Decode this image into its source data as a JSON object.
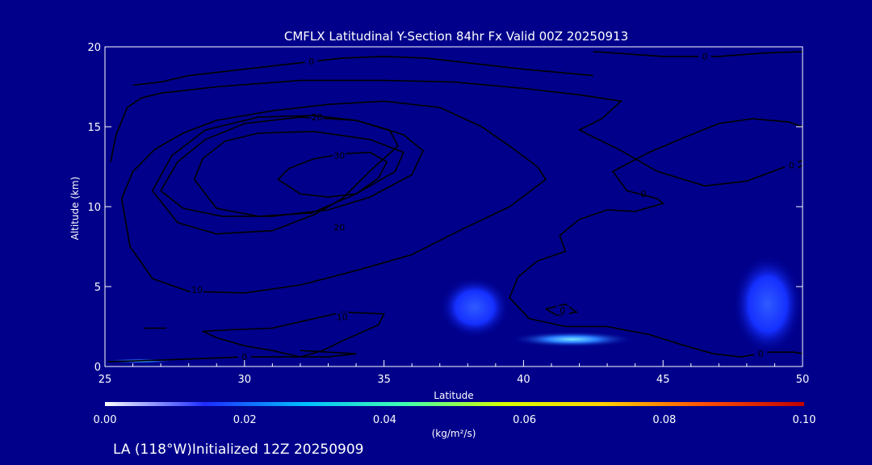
{
  "chart_data": {
    "type": "heatmap",
    "title": "CMFLX Latitudinal Y-Section 84hr  Fx Valid 00Z 20250913",
    "xlabel": "Latitude",
    "ylabel": "Altitude (km)",
    "xlim": [
      25,
      50
    ],
    "ylim": [
      0,
      20
    ],
    "x_ticks": [
      "25",
      "30",
      "35",
      "40",
      "45",
      "50"
    ],
    "y_ticks": [
      "0",
      "5",
      "10",
      "15",
      "20"
    ],
    "grid": false,
    "background_color": "#00008b",
    "contour_color": "#000000",
    "contours": [
      {
        "level": "0",
        "points": [
          [
            26,
            17.6
          ],
          [
            27,
            17.8
          ],
          [
            28,
            18.2
          ],
          [
            30,
            18.6
          ],
          [
            32,
            19.0
          ],
          [
            33.5,
            19.3
          ],
          [
            35,
            19.4
          ],
          [
            36.5,
            19.3
          ],
          [
            38,
            19.0
          ],
          [
            40,
            18.6
          ],
          [
            42.5,
            18.2
          ]
        ],
        "label": [
          32.4,
          19.1
        ]
      },
      {
        "level": "0",
        "points": [
          [
            42.5,
            19.7
          ],
          [
            45,
            19.4
          ],
          [
            47,
            19.4
          ],
          [
            48.5,
            19.6
          ],
          [
            50,
            19.7
          ]
        ],
        "label": [
          46.5,
          19.4
        ]
      },
      {
        "level": "0",
        "points": [
          [
            25.2,
            12.8
          ],
          [
            25.4,
            14.5
          ],
          [
            25.8,
            16.2
          ],
          [
            26.3,
            16.8
          ],
          [
            27,
            17.1
          ],
          [
            29,
            17.5
          ],
          [
            32,
            17.9
          ],
          [
            35,
            17.9
          ],
          [
            37.5,
            17.8
          ],
          [
            40,
            17.4
          ],
          [
            42,
            17.0
          ],
          [
            43.5,
            16.6
          ],
          [
            42.8,
            15.5
          ],
          [
            42,
            14.8
          ],
          [
            43.5,
            13.5
          ],
          [
            44.8,
            12.2
          ],
          [
            46.5,
            11.3
          ],
          [
            48,
            11.6
          ],
          [
            50,
            12.9
          ]
        ],
        "label": [
          44.3,
          10.8
        ]
      },
      {
        "level": "0",
        "points": [
          [
            50,
            15.0
          ],
          [
            49.5,
            15.3
          ],
          [
            48.2,
            15.5
          ],
          [
            47,
            15.2
          ],
          [
            46,
            14.5
          ],
          [
            44.5,
            13.4
          ],
          [
            43.2,
            12.2
          ],
          [
            43.7,
            11.0
          ],
          [
            44.8,
            10.5
          ],
          [
            45,
            10.2
          ],
          [
            44,
            9.7
          ],
          [
            43,
            9.8
          ],
          [
            42,
            9.2
          ],
          [
            41.3,
            8.2
          ],
          [
            41.5,
            7.2
          ],
          [
            40.5,
            6.6
          ],
          [
            39.8,
            5.6
          ],
          [
            39.5,
            4.3
          ],
          [
            40.2,
            3.0
          ],
          [
            41.5,
            2.5
          ],
          [
            43,
            2.5
          ],
          [
            44.5,
            2.0
          ],
          [
            45.8,
            1.3
          ],
          [
            46.8,
            0.8
          ],
          [
            47.8,
            0.6
          ],
          [
            48.8,
            0.9
          ],
          [
            49.7,
            0.9
          ],
          [
            50,
            0.8
          ]
        ],
        "label": [
          48.5,
          0.8
        ]
      },
      {
        "level": "0",
        "points": [
          [
            25.1,
            0.3
          ],
          [
            27,
            0.4
          ],
          [
            30,
            0.6
          ],
          [
            33,
            0.6
          ],
          [
            34,
            0.8
          ],
          [
            32,
            1.0
          ]
        ],
        "label": [
          30,
          0.6
        ]
      },
      {
        "level": "0",
        "points": [
          [
            26.4,
            2.4
          ],
          [
            27.2,
            2.4
          ]
        ],
        "label": null
      },
      {
        "level": "0",
        "points": [
          [
            40.8,
            3.6
          ],
          [
            41.5,
            3.9
          ],
          [
            41.9,
            3.4
          ],
          [
            41.2,
            3.2
          ],
          [
            40.8,
            3.6
          ]
        ],
        "label": [
          41.4,
          3.5
        ]
      },
      {
        "level": "0",
        "points": [
          [
            49.8,
            12.4
          ],
          [
            50,
            12.6
          ]
        ],
        "label": [
          49.6,
          12.6
        ]
      },
      {
        "level": "10",
        "points": [
          [
            25.6,
            10.5
          ],
          [
            26,
            12.2
          ],
          [
            26.8,
            13.6
          ],
          [
            27.8,
            14.6
          ],
          [
            29,
            15.4
          ],
          [
            31,
            16.0
          ],
          [
            33,
            16.4
          ],
          [
            35,
            16.6
          ],
          [
            37,
            16.2
          ],
          [
            38.5,
            15.0
          ],
          [
            39.5,
            13.8
          ],
          [
            40.5,
            12.5
          ],
          [
            40.8,
            11.7
          ],
          [
            39.5,
            10.0
          ],
          [
            37.7,
            8.5
          ],
          [
            36,
            7.0
          ],
          [
            34,
            6.0
          ],
          [
            32,
            5.1
          ],
          [
            30,
            4.6
          ],
          [
            28,
            4.7
          ],
          [
            26.7,
            5.5
          ],
          [
            25.9,
            7.5
          ],
          [
            25.6,
            10.5
          ]
        ],
        "label": [
          28.3,
          4.8
        ]
      },
      {
        "level": "10",
        "points": [
          [
            33.5,
            3.4
          ],
          [
            35,
            3.3
          ],
          [
            34.8,
            2.6
          ],
          [
            33.5,
            1.6
          ],
          [
            32.8,
            1.0
          ],
          [
            32,
            0.6
          ],
          [
            31,
            1.0
          ],
          [
            30,
            1.3
          ],
          [
            29,
            1.8
          ],
          [
            28.5,
            2.2
          ],
          [
            29.5,
            2.3
          ],
          [
            31,
            2.4
          ],
          [
            32.5,
            3.0
          ],
          [
            33.5,
            3.4
          ]
        ],
        "label": [
          33.5,
          3.1
        ]
      },
      {
        "level": "20",
        "points": [
          [
            27,
            11.0
          ],
          [
            27.6,
            12.8
          ],
          [
            28.6,
            14.2
          ],
          [
            30,
            15.2
          ],
          [
            32,
            15.6
          ],
          [
            34,
            15.4
          ],
          [
            35.7,
            14.5
          ],
          [
            36.4,
            13.5
          ],
          [
            36,
            12.0
          ],
          [
            34.5,
            10.6
          ],
          [
            33,
            9.8
          ],
          [
            31,
            9.4
          ],
          [
            29.2,
            9.4
          ],
          [
            27.8,
            9.9
          ],
          [
            27,
            11.0
          ]
        ],
        "label": [
          32.6,
          15.6
        ]
      },
      {
        "level": "20",
        "points": [
          [
            26.7,
            11.0
          ],
          [
            27.4,
            13.2
          ],
          [
            28.6,
            14.8
          ],
          [
            30.5,
            15.6
          ],
          [
            32.5,
            15.7
          ],
          [
            34,
            15.4
          ],
          [
            35.2,
            14.8
          ],
          [
            35.5,
            13.8
          ],
          [
            34.6,
            12.4
          ],
          [
            33.5,
            10.5
          ],
          [
            32.5,
            9.5
          ],
          [
            31,
            8.5
          ],
          [
            29,
            8.3
          ],
          [
            27.6,
            9.0
          ],
          [
            26.7,
            11.0
          ]
        ],
        "label": [
          33.4,
          8.7
        ]
      },
      {
        "level": "30",
        "points": [
          [
            28.2,
            11.7
          ],
          [
            28.5,
            13.0
          ],
          [
            29.3,
            14.1
          ],
          [
            30.5,
            14.6
          ],
          [
            32.5,
            14.7
          ],
          [
            34.5,
            14.2
          ],
          [
            35.7,
            13.4
          ],
          [
            35.4,
            12.2
          ],
          [
            34,
            10.8
          ],
          [
            32.4,
            9.6
          ],
          [
            30.5,
            9.4
          ],
          [
            29,
            9.9
          ],
          [
            28.2,
            11.7
          ]
        ],
        "label": null
      },
      {
        "level": "30",
        "points": [
          [
            31.2,
            11.7
          ],
          [
            31.6,
            12.4
          ],
          [
            32.5,
            13.0
          ],
          [
            33.5,
            13.3
          ],
          [
            34.5,
            13.4
          ],
          [
            35.1,
            12.8
          ],
          [
            34.8,
            11.8
          ],
          [
            34,
            10.8
          ],
          [
            33,
            10.6
          ],
          [
            32,
            10.8
          ],
          [
            31.2,
            11.7
          ]
        ],
        "label": [
          33.4,
          13.2
        ]
      }
    ],
    "filled_regions": [
      {
        "x": [
          37,
          39.5
        ],
        "y": [
          1.8,
          5.6
        ],
        "value": 0.015
      },
      {
        "x": [
          39.5,
          44
        ],
        "y": [
          1.2,
          2.2
        ],
        "value": 0.022
      },
      {
        "x": [
          47.5,
          50
        ],
        "y": [
          0.8,
          7.0
        ],
        "value": 0.014
      },
      {
        "x": [
          25,
          27.5
        ],
        "y": [
          0.2,
          0.5
        ],
        "value": 0.03
      }
    ],
    "colorbar": {
      "label": "(kg/m²/s)",
      "ticks": [
        "0.00",
        "0.02",
        "0.04",
        "0.06",
        "0.08",
        "0.10"
      ],
      "range": [
        0.0,
        0.1
      ],
      "colors": [
        "#ffffff",
        "#1e2cff",
        "#00c0ff",
        "#40ffb0",
        "#d8ff00",
        "#ffd000",
        "#ff5000",
        "#c00000"
      ]
    }
  },
  "footer": {
    "text": "LA (118°W)Initialized 12Z 20250909"
  }
}
